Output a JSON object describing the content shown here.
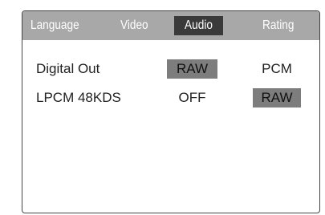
{
  "tabs": {
    "language": "Language",
    "video": "Video",
    "audio": "Audio",
    "rating": "Rating",
    "active": "Audio"
  },
  "settings": [
    {
      "label": "Digital Out",
      "options": [
        "RAW",
        "PCM"
      ],
      "selected": "RAW"
    },
    {
      "label": "LPCM 48KDS",
      "options": [
        "OFF",
        "RAW"
      ],
      "selected": "RAW"
    }
  ],
  "colors": {
    "tab_bar": "#a8a8a8",
    "active_tab": "#3a3a3a",
    "selected_option": "#7d7d7d",
    "border": "#444444"
  }
}
